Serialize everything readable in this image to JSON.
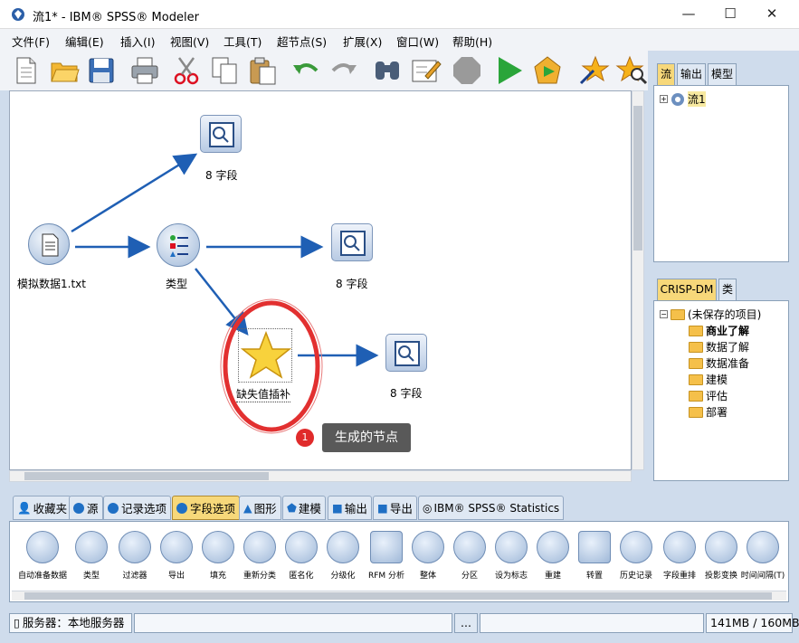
{
  "window": {
    "title": "流1* - IBM® SPSS® Modeler",
    "minimize": "—",
    "maximize": "☐",
    "close": "✕"
  },
  "menu": [
    "文件(F)",
    "编辑(E)",
    "插入(I)",
    "视图(V)",
    "工具(T)",
    "超节点(S)",
    "扩展(X)",
    "窗口(W)",
    "帮助(H)"
  ],
  "toolbar": {
    "icons": [
      "new-file-icon",
      "open-folder-icon",
      "save-icon",
      "print-icon",
      "cut-icon",
      "copy-icon",
      "paste-icon",
      "undo-icon",
      "redo-icon",
      "binoculars-icon",
      "edit-icon",
      "stop-icon",
      "run-icon",
      "run-selection-icon",
      "wand-star-icon",
      "zoom-star-icon"
    ]
  },
  "canvas": {
    "nodes": {
      "source": "模拟数据1.txt",
      "type": "类型",
      "table_top": "8 字段",
      "table_mid": "8 字段",
      "generated": "缺失值插补",
      "table_bottom": "8 字段"
    },
    "callout": {
      "badge": "1",
      "text": "生成的节点"
    }
  },
  "right_panel": {
    "top_tabs": [
      "流",
      "输出",
      "模型"
    ],
    "stream_item": "流1",
    "bottom_tabs": [
      "CRISP-DM",
      "类"
    ],
    "project_root": "(未保存的项目)",
    "project_items": [
      "商业了解",
      "数据了解",
      "数据准备",
      "建模",
      "评估",
      "部署"
    ]
  },
  "palette": {
    "tabs": [
      "收藏夹",
      "源",
      "记录选项",
      "字段选项",
      "图形",
      "建模",
      "输出",
      "导出",
      "IBM® SPSS® Statistics"
    ],
    "nodes": [
      "自动准备数据",
      "类型",
      "过滤器",
      "导出",
      "填充",
      "重新分类",
      "匿名化",
      "分级化",
      "RFM 分析",
      "整体",
      "分区",
      "设为标志",
      "重建",
      "转置",
      "历史记录",
      "字段重排",
      "投影变换",
      "时间间隔(T)"
    ]
  },
  "status": {
    "server": "服务器：本地服务器",
    "memory": "141MB / 160MB",
    "ellipsis": "..."
  },
  "colors": {
    "accent": "#1f6fc4",
    "active_tab": "#f7d87a",
    "highlight": "#e02b2b"
  }
}
